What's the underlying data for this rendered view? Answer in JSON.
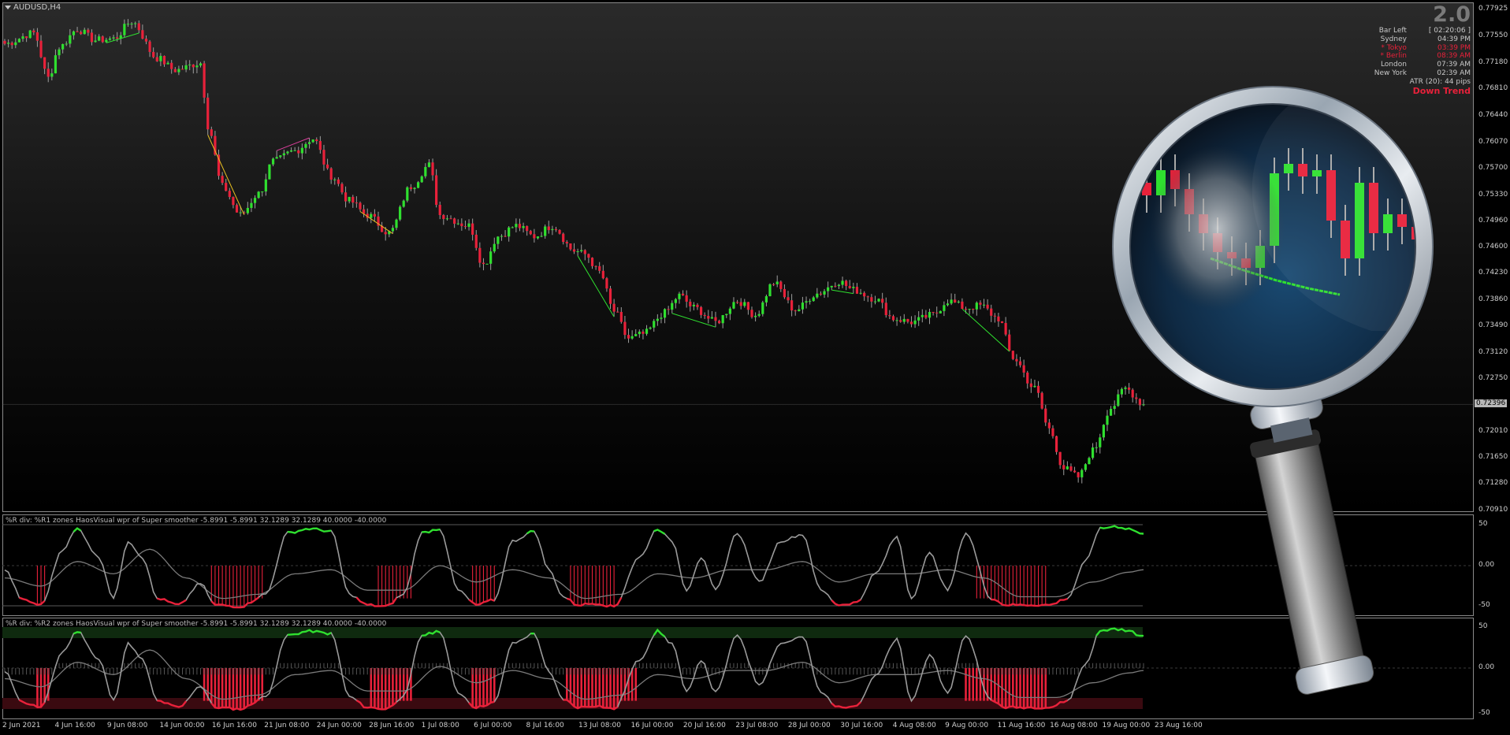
{
  "window": {
    "symbol": "AUDUSD,H4"
  },
  "info_panel": {
    "version": "2.0",
    "rows": [
      {
        "label": "Bar Left",
        "value": "[ 02:20:06 ]",
        "highlight": false
      },
      {
        "label": "Sydney",
        "value": "04:39 PM",
        "highlight": false
      },
      {
        "label": "* Tokyo",
        "value": "03:39 PM",
        "highlight": true
      },
      {
        "label": "* Berlin",
        "value": "08:39 AM",
        "highlight": true
      },
      {
        "label": "London",
        "value": "07:39 AM",
        "highlight": false
      },
      {
        "label": "New York",
        "value": "02:39 AM",
        "highlight": false
      }
    ],
    "atr": "ATR (20): 44 pips",
    "trend": "Down Trend"
  },
  "price_axis": {
    "ticks": [
      "0.77925",
      "0.77550",
      "0.77180",
      "0.76810",
      "0.76440",
      "0.76070",
      "0.75700",
      "0.75330",
      "0.74960",
      "0.74600",
      "0.74230",
      "0.73860",
      "0.73490",
      "0.73120",
      "0.72750",
      "0.72010",
      "0.71650",
      "0.71280",
      "0.70910"
    ],
    "current_price": "0.72396"
  },
  "indicator_1": {
    "label": "%R div: %R1 zones HaosVisual wpr of Super smoother -5.8991 -5.8991 32.1289 32.1289 40.0000 -40.0000",
    "levels": [
      "50",
      "0.00",
      "-50"
    ]
  },
  "indicator_2": {
    "label": "%R div: %R2 zones HaosVisual wpr of Super smoother -5.8991 -5.8991 32.1289 32.1289 40.0000 -40.0000",
    "levels": [
      "50",
      "0.00",
      "-50"
    ]
  },
  "time_axis": {
    "ticks": [
      "2 Jun 2021",
      "4 Jun 16:00",
      "9 Jun 08:00",
      "14 Jun 00:00",
      "16 Jun 16:00",
      "21 Jun 08:00",
      "24 Jun 00:00",
      "28 Jun 16:00",
      "1 Jul 08:00",
      "6 Jul 00:00",
      "8 Jul 16:00",
      "13 Jul 08:00",
      "16 Jul 00:00",
      "20 Jul 16:00",
      "23 Jul 08:00",
      "28 Jul 00:00",
      "30 Jul 16:00",
      "4 Aug 08:00",
      "9 Aug 00:00",
      "11 Aug 16:00",
      "16 Aug 08:00",
      "19 Aug 00:00",
      "23 Aug 16:00"
    ]
  },
  "colors": {
    "background": "#000000",
    "bull": "#2fe02f",
    "bear": "#e8213a",
    "wick": "#9e9e9e",
    "wpr_line": "#9a9a9a",
    "zone_red": "#e8213a",
    "zone_green": "#1c3a1c"
  },
  "chart_data": {
    "type": "candlestick",
    "symbol": "AUDUSD",
    "timeframe": "H4",
    "ylim": [
      0.7091,
      0.7793
    ],
    "current_price": 0.72396,
    "anchors": [
      [
        0,
        0.7745
      ],
      [
        8,
        0.776
      ],
      [
        12,
        0.7697
      ],
      [
        15,
        0.774
      ],
      [
        20,
        0.7765
      ],
      [
        25,
        0.775
      ],
      [
        30,
        0.7752
      ],
      [
        35,
        0.7776
      ],
      [
        42,
        0.7725
      ],
      [
        47,
        0.7708
      ],
      [
        54,
        0.7718
      ],
      [
        56,
        0.763
      ],
      [
        60,
        0.7545
      ],
      [
        65,
        0.7505
      ],
      [
        70,
        0.7535
      ],
      [
        74,
        0.758
      ],
      [
        80,
        0.7595
      ],
      [
        85,
        0.7612
      ],
      [
        90,
        0.756
      ],
      [
        95,
        0.7525
      ],
      [
        100,
        0.7505
      ],
      [
        106,
        0.748
      ],
      [
        112,
        0.7545
      ],
      [
        117,
        0.7575
      ],
      [
        120,
        0.7505
      ],
      [
        128,
        0.749
      ],
      [
        132,
        0.7435
      ],
      [
        136,
        0.7475
      ],
      [
        141,
        0.749
      ],
      [
        146,
        0.7475
      ],
      [
        151,
        0.749
      ],
      [
        157,
        0.7455
      ],
      [
        160,
        0.745
      ],
      [
        164,
        0.7425
      ],
      [
        168,
        0.737
      ],
      [
        172,
        0.7332
      ],
      [
        176,
        0.7338
      ],
      [
        182,
        0.7368
      ],
      [
        186,
        0.7392
      ],
      [
        190,
        0.7375
      ],
      [
        196,
        0.7355
      ],
      [
        202,
        0.7385
      ],
      [
        207,
        0.7365
      ],
      [
        212,
        0.741
      ],
      [
        218,
        0.7372
      ],
      [
        224,
        0.7395
      ],
      [
        230,
        0.7412
      ],
      [
        234,
        0.74
      ],
      [
        240,
        0.7388
      ],
      [
        245,
        0.736
      ],
      [
        250,
        0.7355
      ],
      [
        256,
        0.7365
      ],
      [
        260,
        0.7385
      ],
      [
        265,
        0.7375
      ],
      [
        269,
        0.7378
      ],
      [
        274,
        0.736
      ],
      [
        278,
        0.7305
      ],
      [
        284,
        0.7262
      ],
      [
        288,
        0.7205
      ],
      [
        292,
        0.715
      ],
      [
        296,
        0.7138
      ],
      [
        300,
        0.7175
      ],
      [
        305,
        0.7235
      ],
      [
        309,
        0.7262
      ],
      [
        314,
        0.724
      ]
    ],
    "candle_count": 315,
    "indicator_1": {
      "name": "%R1 zones",
      "levels": [
        50,
        0,
        -50
      ],
      "fast_anchors": [
        [
          0,
          -5
        ],
        [
          5,
          -42
        ],
        [
          10,
          -48
        ],
        [
          16,
          20
        ],
        [
          20,
          45
        ],
        [
          26,
          10
        ],
        [
          30,
          -40
        ],
        [
          34,
          30
        ],
        [
          38,
          10
        ],
        [
          42,
          -40
        ],
        [
          48,
          -48
        ],
        [
          54,
          -22
        ],
        [
          58,
          -48
        ],
        [
          65,
          -50
        ],
        [
          72,
          -35
        ],
        [
          78,
          40
        ],
        [
          84,
          45
        ],
        [
          90,
          42
        ],
        [
          95,
          -35
        ],
        [
          100,
          -48
        ],
        [
          105,
          -50
        ],
        [
          110,
          -35
        ],
        [
          115,
          40
        ],
        [
          120,
          45
        ],
        [
          125,
          -30
        ],
        [
          130,
          -48
        ],
        [
          135,
          -42
        ],
        [
          140,
          30
        ],
        [
          146,
          42
        ],
        [
          150,
          -5
        ],
        [
          154,
          -38
        ],
        [
          158,
          -48
        ],
        [
          163,
          -46
        ],
        [
          168,
          -50
        ],
        [
          175,
          10
        ],
        [
          180,
          45
        ],
        [
          184,
          30
        ],
        [
          188,
          -30
        ],
        [
          192,
          10
        ],
        [
          196,
          -30
        ],
        [
          202,
          40
        ],
        [
          208,
          -20
        ],
        [
          214,
          30
        ],
        [
          220,
          38
        ],
        [
          225,
          -30
        ],
        [
          230,
          -48
        ],
        [
          235,
          -45
        ],
        [
          240,
          -10
        ],
        [
          246,
          35
        ],
        [
          250,
          -40
        ],
        [
          255,
          15
        ],
        [
          260,
          -30
        ],
        [
          265,
          40
        ],
        [
          272,
          -40
        ],
        [
          276,
          -48
        ],
        [
          282,
          -48
        ],
        [
          288,
          -48
        ],
        [
          293,
          -40
        ],
        [
          298,
          5
        ],
        [
          302,
          45
        ],
        [
          306,
          48
        ],
        [
          310,
          45
        ],
        [
          314,
          38
        ]
      ],
      "slow_anchors": [
        [
          0,
          -15
        ],
        [
          10,
          -25
        ],
        [
          20,
          5
        ],
        [
          30,
          -10
        ],
        [
          40,
          20
        ],
        [
          50,
          -15
        ],
        [
          60,
          -40
        ],
        [
          70,
          -35
        ],
        [
          80,
          -10
        ],
        [
          90,
          -5
        ],
        [
          100,
          -30
        ],
        [
          110,
          -30
        ],
        [
          120,
          0
        ],
        [
          130,
          -20
        ],
        [
          140,
          -5
        ],
        [
          150,
          -15
        ],
        [
          160,
          -40
        ],
        [
          170,
          -35
        ],
        [
          180,
          -10
        ],
        [
          190,
          -15
        ],
        [
          200,
          -5
        ],
        [
          210,
          -5
        ],
        [
          220,
          5
        ],
        [
          230,
          -20
        ],
        [
          240,
          -10
        ],
        [
          250,
          -10
        ],
        [
          260,
          -5
        ],
        [
          270,
          -15
        ],
        [
          280,
          -38
        ],
        [
          290,
          -38
        ],
        [
          300,
          -20
        ],
        [
          310,
          -8
        ],
        [
          314,
          -5
        ]
      ],
      "zone_ranges": [
        [
          9,
          11
        ],
        [
          57,
          71
        ],
        [
          103,
          112
        ],
        [
          129,
          135
        ],
        [
          156,
          168
        ],
        [
          268,
          287
        ]
      ]
    },
    "indicator_2": {
      "name": "%R2 zones",
      "levels": [
        50,
        0,
        -50
      ],
      "zone_ranges": [
        [
          9,
          12
        ],
        [
          55,
          71
        ],
        [
          101,
          112
        ],
        [
          129,
          135
        ],
        [
          155,
          174
        ],
        [
          265,
          287
        ]
      ]
    }
  }
}
